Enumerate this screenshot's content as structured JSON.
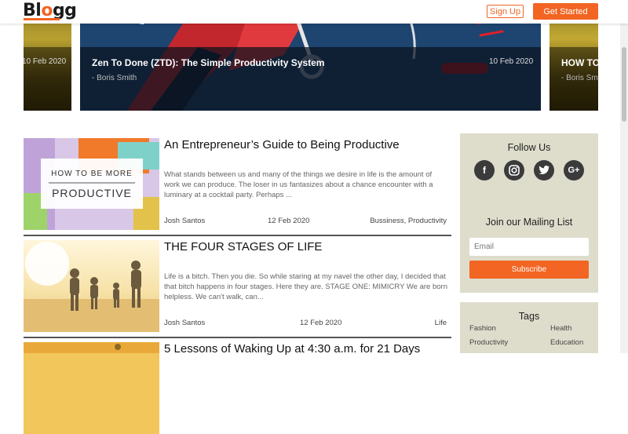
{
  "brand": {
    "logo": "Blogg",
    "accent": "#f26522"
  },
  "nav": {
    "signup": "Sign Up",
    "get_started": "Get Started"
  },
  "carousel": {
    "left": {
      "date": "10 Feb 2020"
    },
    "center": {
      "title": "Zen To Done (ZTD): The Simple Productivity System",
      "author": "- Boris Smith",
      "date": "10 Feb 2020"
    },
    "right": {
      "title": "HOW TO",
      "author": "- Boris Sm"
    }
  },
  "posts": [
    {
      "title": "An Entrepreneur’s Guide to Being Productive",
      "excerpt": "What stands between us and many of the things we desire in life is the amount of work we can produce. The loser in us fantasizes about a chance encounter with a luminary at a cocktail party. Perhaps ...",
      "author": "Josh Santos",
      "date": "12 Feb 2020",
      "categories": "Bussiness, Productivity",
      "thumb_text_1": "HOW TO BE MORE",
      "thumb_text_2": "PRODUCTIVE"
    },
    {
      "title": "THE FOUR STAGES OF LIFE",
      "excerpt": "Life is a bitch. Then you die. So while staring at my navel the other day, I decided that that bitch happens in four stages. Here they are. STAGE ONE: MIMICRY We are born helpless. We can't walk, can...",
      "author": "Josh Santos",
      "date": "12 Feb 2020",
      "categories": "Life"
    },
    {
      "title": "5 Lessons of Waking Up at 4:30 a.m. for 21 Days"
    }
  ],
  "sidebar": {
    "follow_title": "Follow Us",
    "social": [
      "facebook-icon",
      "instagram-icon",
      "twitter-icon",
      "google-plus-icon"
    ],
    "social_glyphs": {
      "google_plus": "G+"
    },
    "mailing_title": "Join our Mailing List",
    "email_placeholder": "Email",
    "subscribe": "Subscribe",
    "tags_title": "Tags",
    "tags": [
      "Fashion",
      "Health",
      "Productivity",
      "Education"
    ]
  }
}
